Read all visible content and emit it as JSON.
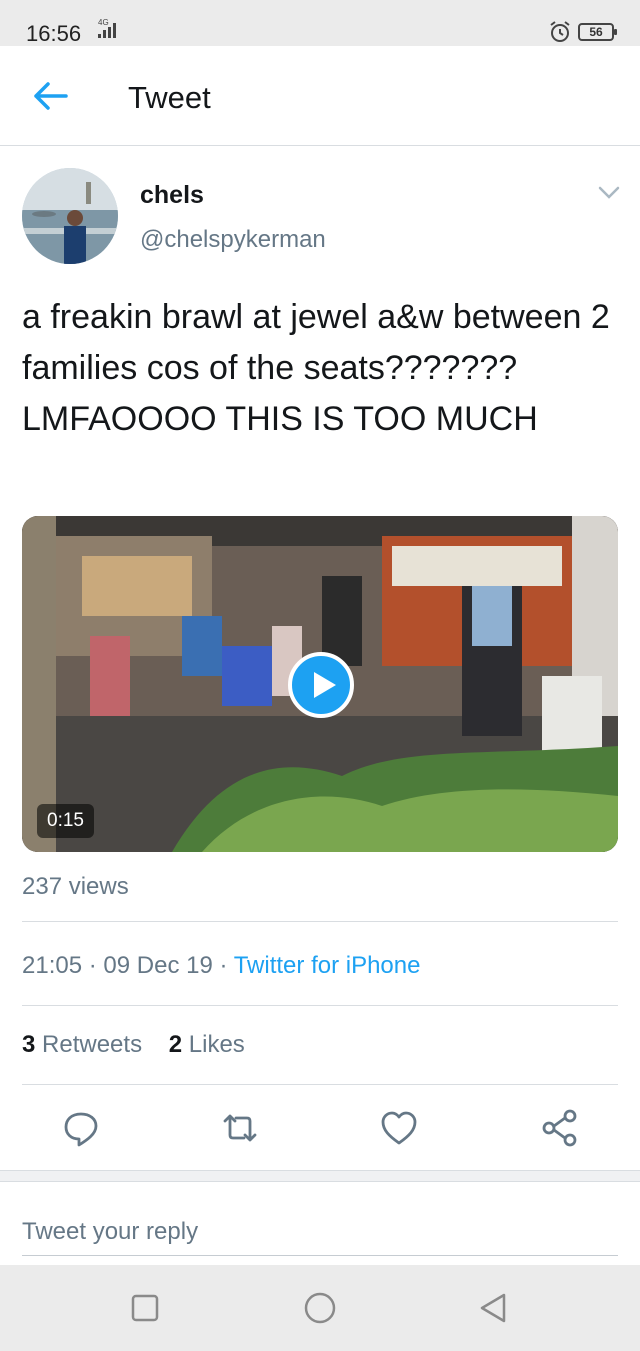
{
  "status_bar": {
    "time": "16:56",
    "network": "4G",
    "battery": "56",
    "icons": [
      "signal-icon",
      "alarm-icon",
      "battery-icon"
    ]
  },
  "header": {
    "title": "Tweet",
    "back_icon": "arrow-left-icon"
  },
  "tweet": {
    "author": {
      "name": "chels",
      "handle": "@chelspykerman"
    },
    "text": "a freakin brawl at jewel a&w between 2 families cos of the seats??????? LMFAOOOO THIS IS TOO MUCH",
    "media": {
      "type": "video",
      "duration": "0:15",
      "play_icon": "play-icon"
    },
    "views": "237 views",
    "time": "21:05",
    "date": "09 Dec 19",
    "source": "Twitter for iPhone",
    "retweets_count": "3",
    "retweets_label": "Retweets",
    "likes_count": "2",
    "likes_label": "Likes"
  },
  "actions": [
    "reply-icon",
    "retweet-icon",
    "like-icon",
    "share-icon"
  ],
  "reply": {
    "placeholder": "Tweet your reply"
  },
  "nav": [
    "recents-icon",
    "home-icon",
    "back-icon"
  ],
  "colors": {
    "accent": "#1da1f2",
    "text": "#14171a",
    "muted": "#657786"
  }
}
